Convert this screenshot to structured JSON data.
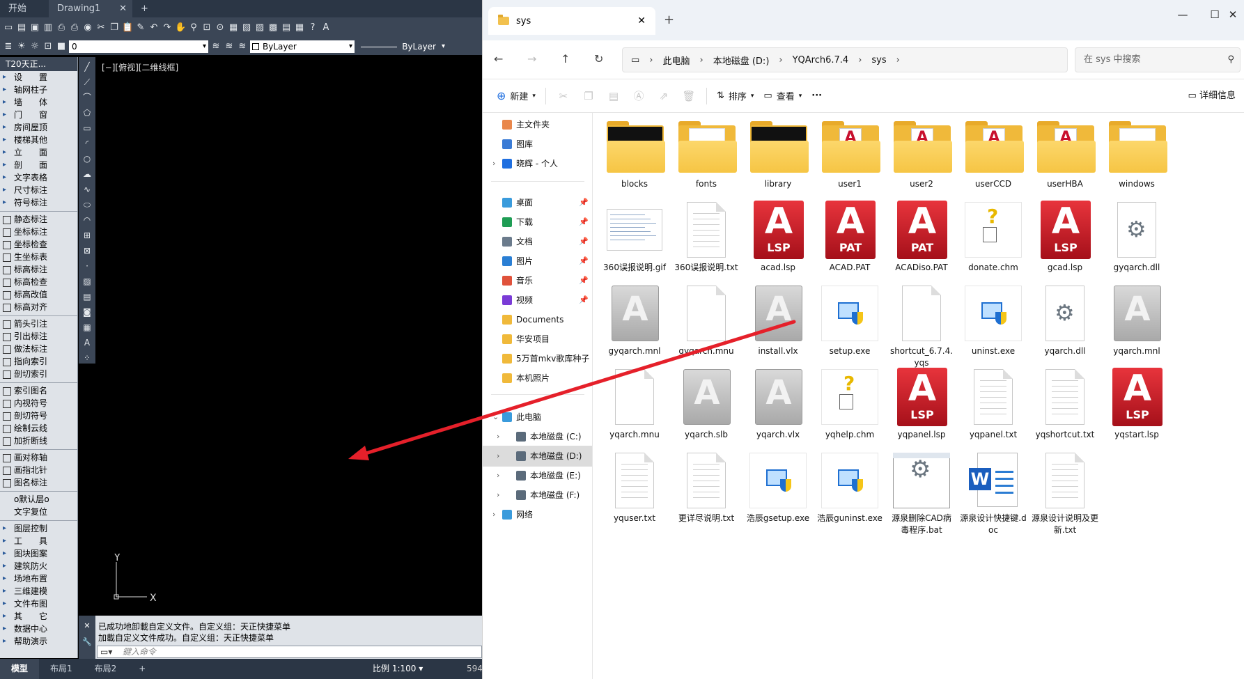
{
  "cad": {
    "tabs": [
      "开始",
      "Drawing1"
    ],
    "new_tab": "+",
    "layer_value": "0",
    "color_value": "ByLayer",
    "linetype_value": "ByLayer",
    "panel_title": "T20天正...",
    "panel_items": [
      {
        "label": "设　　置",
        "kind": "sec"
      },
      {
        "label": "轴网柱子",
        "kind": "sec"
      },
      {
        "label": "墙　　体",
        "kind": "sec"
      },
      {
        "label": "门　　窗",
        "kind": "sec"
      },
      {
        "label": "房间屋顶",
        "kind": "sec"
      },
      {
        "label": "楼梯其他",
        "kind": "sec"
      },
      {
        "label": "立　　面",
        "kind": "sec"
      },
      {
        "label": "剖　　面",
        "kind": "sec"
      },
      {
        "label": "文字表格",
        "kind": "sec"
      },
      {
        "label": "尺寸标注",
        "kind": "sec"
      },
      {
        "label": "符号标注",
        "kind": "sec"
      },
      {
        "label": "",
        "kind": "sep"
      },
      {
        "label": "静态标注",
        "kind": "tool"
      },
      {
        "label": "坐标标注",
        "kind": "tool"
      },
      {
        "label": "坐标检查",
        "kind": "tool"
      },
      {
        "label": "生坐标表",
        "kind": "tool"
      },
      {
        "label": "标高标注",
        "kind": "tool"
      },
      {
        "label": "标高检查",
        "kind": "tool"
      },
      {
        "label": "标高改值",
        "kind": "tool"
      },
      {
        "label": "标高对齐",
        "kind": "tool"
      },
      {
        "label": "",
        "kind": "sep"
      },
      {
        "label": "箭头引注",
        "kind": "tool"
      },
      {
        "label": "引出标注",
        "kind": "tool"
      },
      {
        "label": "做法标注",
        "kind": "tool"
      },
      {
        "label": "指向索引",
        "kind": "tool"
      },
      {
        "label": "剖切索引",
        "kind": "tool"
      },
      {
        "label": "",
        "kind": "sep"
      },
      {
        "label": "索引图名",
        "kind": "tool"
      },
      {
        "label": "内视符号",
        "kind": "tool"
      },
      {
        "label": "剖切符号",
        "kind": "tool"
      },
      {
        "label": "绘制云线",
        "kind": "tool"
      },
      {
        "label": "加折断线",
        "kind": "tool"
      },
      {
        "label": "",
        "kind": "sep"
      },
      {
        "label": "画对称轴",
        "kind": "tool"
      },
      {
        "label": "画指北针",
        "kind": "tool"
      },
      {
        "label": "图名标注",
        "kind": "tool"
      },
      {
        "label": "",
        "kind": "sep"
      },
      {
        "label": "o默认层o",
        "kind": "plain"
      },
      {
        "label": "文字复位",
        "kind": "plain"
      },
      {
        "label": "",
        "kind": "sep"
      },
      {
        "label": "图层控制",
        "kind": "sec"
      },
      {
        "label": "工　　具",
        "kind": "sec"
      },
      {
        "label": "图块图案",
        "kind": "sec"
      },
      {
        "label": "建筑防火",
        "kind": "sec"
      },
      {
        "label": "场地布置",
        "kind": "sec"
      },
      {
        "label": "三维建模",
        "kind": "sec"
      },
      {
        "label": "文件布图",
        "kind": "sec"
      },
      {
        "label": "其　　它",
        "kind": "sec"
      },
      {
        "label": "数据中心",
        "kind": "sec"
      },
      {
        "label": "帮助演示",
        "kind": "sec"
      }
    ],
    "viewport_label": "[−][俯视][二维线框]",
    "ucs_y": "Y",
    "ucs_x": "X",
    "command_history": [
      "已成功地卸載自定义文件。自定义组：天正快捷菜单",
      "加載自定义文件成功。自定义组：天正快捷菜单"
    ],
    "command_placeholder": "鍵入命令",
    "layout_tabs": [
      "模型",
      "布局1",
      "布局2"
    ],
    "scale_label": "比例 1:100",
    "coords": "594"
  },
  "explorer": {
    "tab_title": "sys",
    "address": [
      "此电脑",
      "本地磁盘 (D:)",
      "YQArch6.7.4",
      "sys"
    ],
    "search_placeholder": "在 sys 中搜索",
    "new_label": "新建",
    "sort_label": "排序",
    "view_label": "查看",
    "more_label": "···",
    "details_label": "详细信息",
    "nav": [
      {
        "label": "主文件夹",
        "color": "#e9874b",
        "pin": false,
        "exp": false
      },
      {
        "label": "图库",
        "color": "#3a7bd5",
        "pin": false,
        "exp": false
      },
      {
        "label": "晓辉 - 个人",
        "color": "#1f6fe0",
        "pin": false,
        "exp": true
      },
      {
        "label": "桌面",
        "color": "#3a9bdc",
        "pin": true,
        "exp": false
      },
      {
        "label": "下载",
        "color": "#1f9d55",
        "pin": true,
        "exp": false
      },
      {
        "label": "文档",
        "color": "#6b7b8c",
        "pin": true,
        "exp": false
      },
      {
        "label": "图片",
        "color": "#2a7fd4",
        "pin": true,
        "exp": false
      },
      {
        "label": "音乐",
        "color": "#e0523b",
        "pin": true,
        "exp": false
      },
      {
        "label": "视频",
        "color": "#7a3bd6",
        "pin": true,
        "exp": false
      },
      {
        "label": "Documents",
        "color": "#f0b93a",
        "pin": false,
        "exp": false
      },
      {
        "label": "华安项目",
        "color": "#f0b93a",
        "pin": false,
        "exp": false
      },
      {
        "label": "5万首mkv歌库种子",
        "color": "#f0b93a",
        "pin": false,
        "exp": false
      },
      {
        "label": "本机照片",
        "color": "#f0b93a",
        "pin": false,
        "exp": false
      },
      {
        "label": "此电脑",
        "color": "#3a9bdc",
        "pin": false,
        "exp": true
      },
      {
        "label": "本地磁盘 (C:)",
        "color": "#5b6b7b",
        "pin": false,
        "exp": true
      },
      {
        "label": "本地磁盘 (D:)",
        "color": "#5b6b7b",
        "pin": false,
        "exp": true
      },
      {
        "label": "本地磁盘 (E:)",
        "color": "#5b6b7b",
        "pin": false,
        "exp": true
      },
      {
        "label": "本地磁盘 (F:)",
        "color": "#5b6b7b",
        "pin": false,
        "exp": true
      },
      {
        "label": "网络",
        "color": "#3a9bdc",
        "pin": false,
        "exp": true
      }
    ],
    "files": [
      {
        "name": "blocks",
        "type": "folder-dark"
      },
      {
        "name": "fonts",
        "type": "folder"
      },
      {
        "name": "library",
        "type": "folder-dark"
      },
      {
        "name": "user1",
        "type": "folder-acad"
      },
      {
        "name": "user2",
        "type": "folder-acad"
      },
      {
        "name": "userCCD",
        "type": "folder-acad"
      },
      {
        "name": "userHBA",
        "type": "folder-acad"
      },
      {
        "name": "windows",
        "type": "folder"
      },
      {
        "name": "360误报说明.gif",
        "type": "gif"
      },
      {
        "name": "360误报说明.txt",
        "type": "txt"
      },
      {
        "name": "acad.lsp",
        "type": "acad",
        "tag": "LSP"
      },
      {
        "name": "ACAD.PAT",
        "type": "acad",
        "tag": "PAT"
      },
      {
        "name": "ACADiso.PAT",
        "type": "acad",
        "tag": "PAT"
      },
      {
        "name": "donate.chm",
        "type": "chm"
      },
      {
        "name": "gcad.lsp",
        "type": "acad",
        "tag": "LSP"
      },
      {
        "name": "gyqarch.dll",
        "type": "gear"
      },
      {
        "name": "gyqarch.mnl",
        "type": "gray"
      },
      {
        "name": "gyqarch.mnu",
        "type": "doc"
      },
      {
        "name": "install.vlx",
        "type": "gray"
      },
      {
        "name": "setup.exe",
        "type": "exe"
      },
      {
        "name": "shortcut_6.7.4.yqs",
        "type": "doc"
      },
      {
        "name": "uninst.exe",
        "type": "exe"
      },
      {
        "name": "yqarch.dll",
        "type": "gear"
      },
      {
        "name": "yqarch.mnl",
        "type": "gray"
      },
      {
        "name": "yqarch.mnu",
        "type": "doc"
      },
      {
        "name": "yqarch.slb",
        "type": "gray"
      },
      {
        "name": "yqarch.vlx",
        "type": "gray"
      },
      {
        "name": "yqhelp.chm",
        "type": "chm"
      },
      {
        "name": "yqpanel.lsp",
        "type": "acad",
        "tag": "LSP"
      },
      {
        "name": "yqpanel.txt",
        "type": "txt"
      },
      {
        "name": "yqshortcut.txt",
        "type": "txt"
      },
      {
        "name": "yqstart.lsp",
        "type": "acad",
        "tag": "LSP"
      },
      {
        "name": "yquser.txt",
        "type": "txt"
      },
      {
        "name": "更详尽说明.txt",
        "type": "txt"
      },
      {
        "name": "浩辰gsetup.exe",
        "type": "exe"
      },
      {
        "name": "浩辰guninst.exe",
        "type": "exe"
      },
      {
        "name": "源泉删除CAD病毒程序.bat",
        "type": "bat"
      },
      {
        "name": "源泉设计快捷键.doc",
        "type": "word"
      },
      {
        "name": "源泉设计说明及更新.txt",
        "type": "txt"
      }
    ]
  },
  "colors": {
    "annotation_arrow": "#e5202a",
    "cad_bg": "#000000",
    "cad_chrome": "#3b4656"
  }
}
